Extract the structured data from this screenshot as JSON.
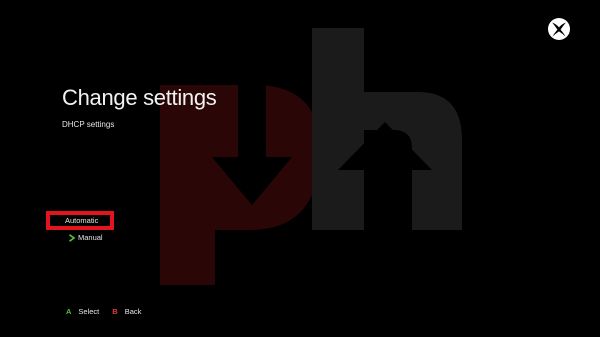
{
  "header": {
    "title": "Change settings",
    "subtitle": "DHCP settings",
    "logo_icon": "xbox-logo-icon"
  },
  "options": [
    {
      "label": "Automatic",
      "state": "highlighted"
    },
    {
      "label": "Manual",
      "state": "current",
      "indicator_icon": "chevron-right-icon"
    }
  ],
  "footer": {
    "select_button": "A",
    "select_label": "Select",
    "back_button": "B",
    "back_label": "Back"
  },
  "colors": {
    "background": "#000000",
    "highlight_border": "#e4141e",
    "button_a": "#5bbf3a",
    "button_b": "#e23c3c",
    "watermark_red": "#2a0606",
    "watermark_gray": "#1b1b1b"
  }
}
